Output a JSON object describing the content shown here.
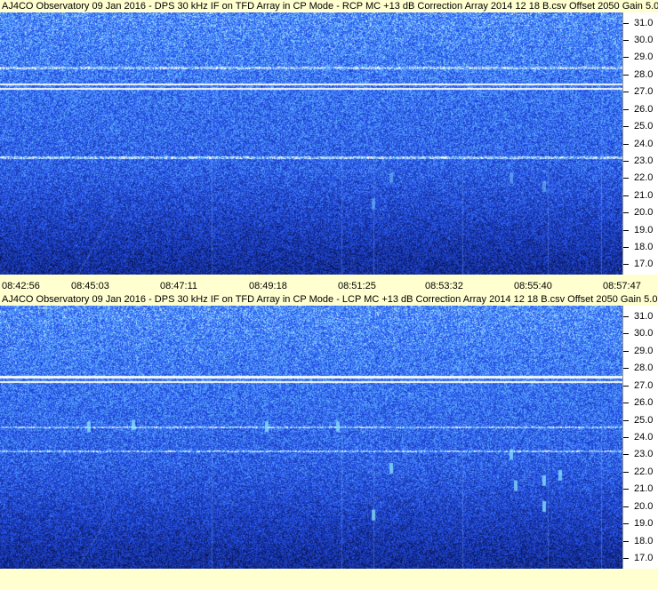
{
  "chart_data": [
    {
      "type": "heatmap",
      "title": "AJ4CO Observatory 09 Jan 2016 - DPS 30 kHz IF on TFD Array in CP Mode - RCP  MC +13 dB  Correction Array 2014 12 18 B.csv  Offset 2050  Gain 5.0",
      "xlabel": "",
      "ylabel": "",
      "x_ticks": [
        "08:42:56",
        "08:45:03",
        "08:47:11",
        "08:49:18",
        "08:51:25",
        "08:53:32",
        "08:55:40",
        "08:57:47"
      ],
      "y_ticks": [
        31.0,
        30.0,
        29.0,
        28.0,
        27.0,
        26.0,
        25.0,
        24.0,
        23.0,
        22.0,
        21.0,
        20.0,
        19.0,
        18.0,
        17.0
      ],
      "ylim": [
        16.4,
        31.6
      ],
      "features": [
        {
          "freq": 27.2,
          "kind": "hline",
          "intensity": 0.95
        },
        {
          "freq": 27.45,
          "kind": "hline",
          "intensity": 0.7
        },
        {
          "freq": 23.2,
          "kind": "hline",
          "intensity": 0.35
        },
        {
          "freq": 28.4,
          "kind": "hline",
          "intensity": 0.25
        }
      ]
    },
    {
      "type": "heatmap",
      "title": "AJ4CO Observatory 09 Jan 2016 - DPS 30 kHz IF on TFD Array in CP Mode - LCP  MC +13 dB  Correction Array 2014 12 18 B.csv  Offset 2050  Gain 5.0",
      "xlabel": "",
      "ylabel": "",
      "x_ticks": [],
      "y_ticks": [
        31.0,
        30.0,
        29.0,
        28.0,
        27.0,
        26.0,
        25.0,
        24.0,
        23.0,
        22.0,
        21.0,
        20.0,
        19.0,
        18.0,
        17.0
      ],
      "ylim": [
        16.4,
        31.6
      ],
      "features": [
        {
          "freq": 27.2,
          "kind": "hline",
          "intensity": 0.95
        },
        {
          "freq": 27.5,
          "kind": "hline",
          "intensity": 0.75
        },
        {
          "freq": 24.6,
          "kind": "hline",
          "intensity": 0.3
        },
        {
          "freq": 23.2,
          "kind": "hline",
          "intensity": 0.3
        }
      ]
    }
  ],
  "colors": {
    "background": "#FFFFD0",
    "spectro_low": "#0b1f7a",
    "spectro_mid": "#1d45d8",
    "spectro_high": "#6aa8ff",
    "spectro_peak": "#e8f4ff"
  }
}
